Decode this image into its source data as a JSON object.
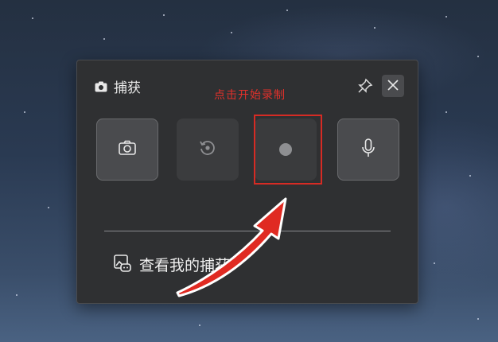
{
  "panel": {
    "title": "捕获",
    "title_icon": "camera-icon",
    "pin_icon": "pin-icon",
    "close_icon": "close-icon"
  },
  "annotation": {
    "text": "点击开始录制",
    "color": "#e0312b"
  },
  "buttons": [
    {
      "name": "screenshot",
      "icon": "camera-icon"
    },
    {
      "name": "replay",
      "icon": "replay-icon"
    },
    {
      "name": "record",
      "icon": "record-icon",
      "highlighted": true
    },
    {
      "name": "microphone",
      "icon": "microphone-icon"
    }
  ],
  "view_captures": {
    "label": "查看我的捕获",
    "icon": "gallery-gamepad-icon"
  },
  "colors": {
    "panel_bg": "#2f3032",
    "annotation_red": "#e0312b"
  }
}
